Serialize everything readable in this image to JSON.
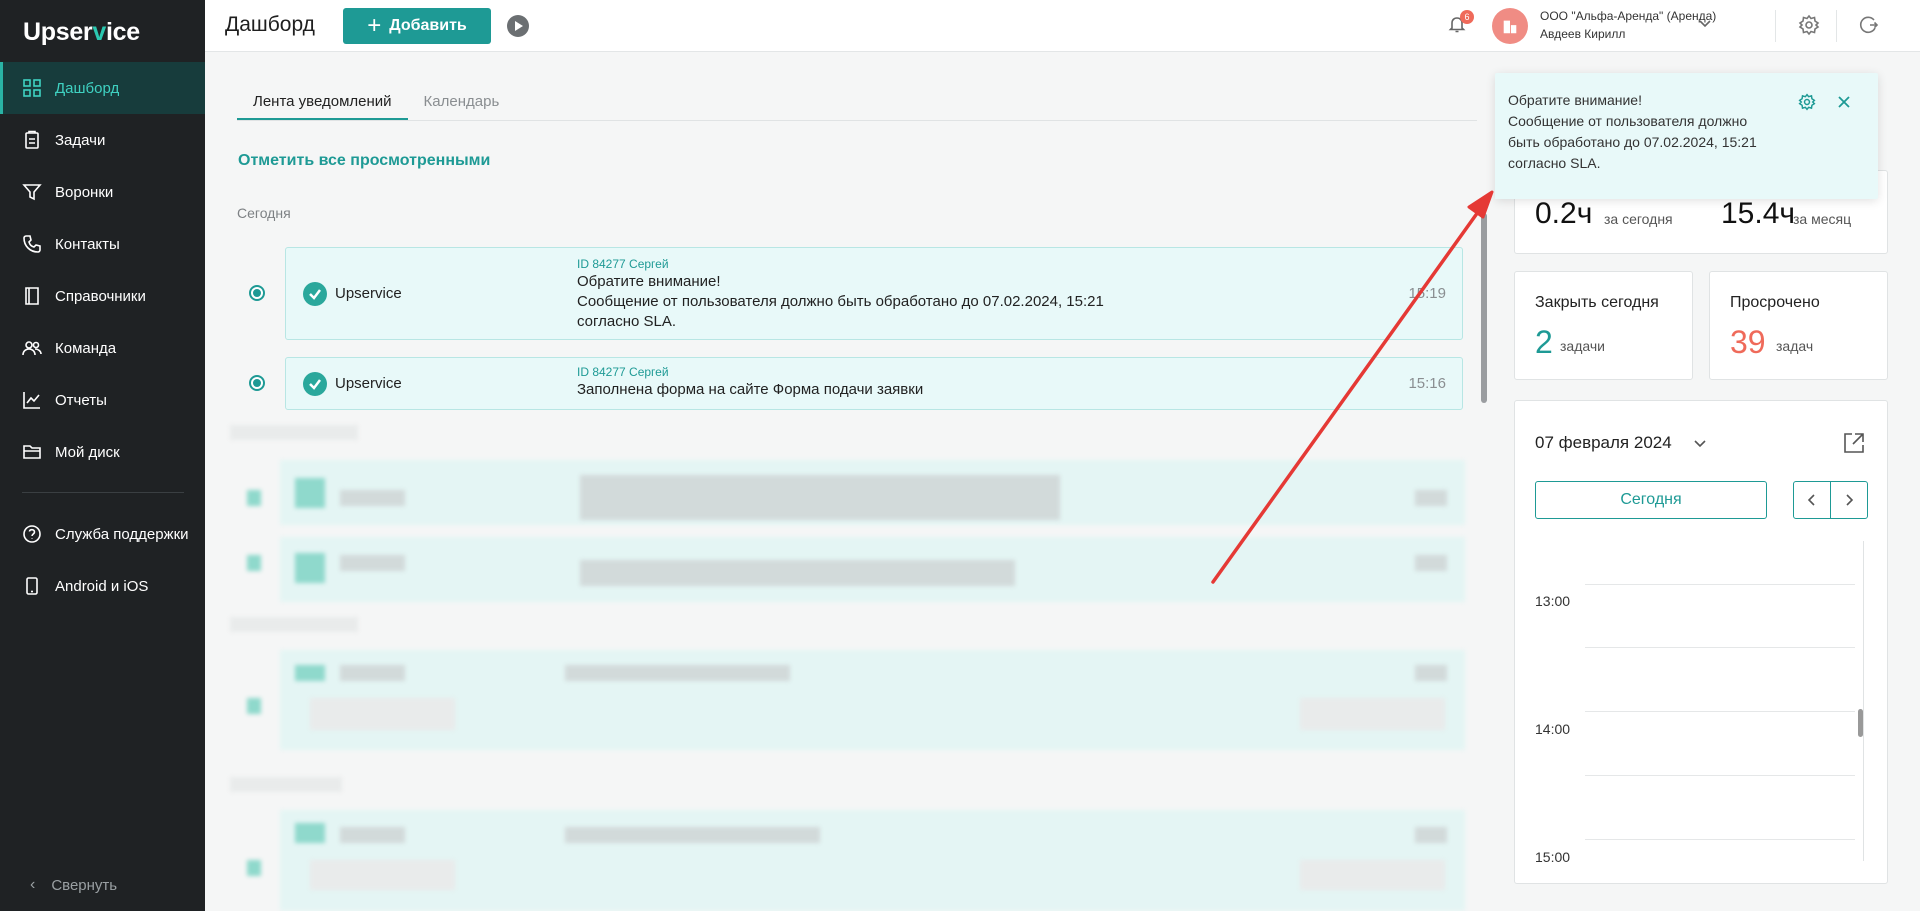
{
  "brand": {
    "logo_pre": "Upser",
    "logo_v": "v",
    "logo_post": "ice"
  },
  "sidebar": {
    "items": [
      {
        "label": "Дашборд",
        "icon": "dashboard-icon"
      },
      {
        "label": "Задачи",
        "icon": "tasks-icon"
      },
      {
        "label": "Воронки",
        "icon": "funnel-icon"
      },
      {
        "label": "Контакты",
        "icon": "phone-icon"
      },
      {
        "label": "Справочники",
        "icon": "book-icon"
      },
      {
        "label": "Команда",
        "icon": "team-icon"
      },
      {
        "label": "Отчеты",
        "icon": "chart-icon"
      },
      {
        "label": "Мой диск",
        "icon": "folder-icon"
      }
    ],
    "secondary": [
      {
        "label": "Служба поддержки",
        "icon": "help-icon"
      },
      {
        "label": "Android и iOS",
        "icon": "mobile-icon"
      }
    ],
    "collapse_label": "Свернуть"
  },
  "header": {
    "title": "Дашборд",
    "add_label": "Добавить",
    "bell_count": "6",
    "org_name": "ООО \"Альфа-Аренда\" (Аренда)",
    "user_name": "Авдеев Кирилл"
  },
  "feed": {
    "tabs": [
      "Лента уведомлений",
      "Календарь"
    ],
    "mark_all": "Отметить все просмотренными",
    "section_today": "Сегодня",
    "notifications": [
      {
        "source": "Upservice",
        "meta": "ID 84277 Сергей",
        "line1": "Обратите внимание!",
        "line2": "Сообщение от пользователя должно быть обработано до 07.02.2024, 15:21",
        "line3": "согласно SLA.",
        "time": "15:19"
      },
      {
        "source": "Upservice",
        "meta": "ID 84277 Сергей",
        "line1": "Заполнена форма на сайте Форма подачи заявки",
        "time": "15:16"
      }
    ]
  },
  "stats": {
    "today_value": "0.2ч",
    "today_label": "за сегодня",
    "month_value": "15.4ч",
    "month_label": "за месяц"
  },
  "close_today": {
    "title": "Закрыть сегодня",
    "value": "2",
    "unit": "задачи"
  },
  "overdue": {
    "title": "Просрочено",
    "value": "39",
    "unit": "задач"
  },
  "calendar": {
    "date": "07 февраля 2024",
    "today_btn": "Сегодня",
    "hours": [
      "13:00",
      "14:00",
      "15:00"
    ]
  },
  "toast": {
    "line1": "Обратите внимание!",
    "line2": "Сообщение от пользователя должно",
    "line3": "быть обработано до 07.02.2024, 15:21",
    "line4": "согласно SLA."
  },
  "colors": {
    "accent": "#1e9a95",
    "danger": "#ef6a5a",
    "sidebar": "#1f2224"
  }
}
